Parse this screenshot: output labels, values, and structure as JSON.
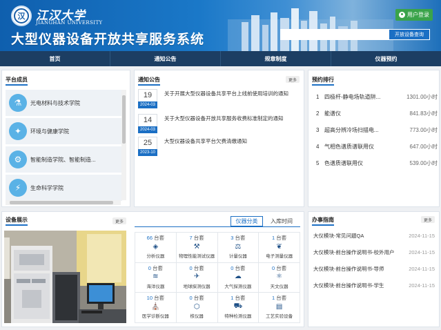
{
  "header": {
    "university_cn": "江汉大学",
    "university_en": "JIANGHAN UNIVERSITY",
    "system_title": "大型仪器设备开放共享服务系统",
    "login_label": "用户登录",
    "search_placeholder": "",
    "search_button": "开放设备查询"
  },
  "nav": [
    "首页",
    "通知公告",
    "规章制度",
    "仪器预约"
  ],
  "members": {
    "title": "平台成员",
    "items": [
      {
        "name": "光电材料与技术学院",
        "icon": "flask-icon"
      },
      {
        "name": "环境与健康学院",
        "icon": "microscope-icon"
      },
      {
        "name": "智能制造学院、智能制造...",
        "icon": "gear-icon"
      },
      {
        "name": "生命科学学院",
        "icon": "bolt-icon"
      }
    ]
  },
  "notices": {
    "title": "通知公告",
    "more": "更多",
    "items": [
      {
        "day": "19",
        "ym": "2024-03",
        "text": "关于开展大型仪器设备共享平台上线前使用培训的通知"
      },
      {
        "day": "14",
        "ym": "2024-03",
        "text": "关于大型仪器设备开放共享服务收费标准制定的通知"
      },
      {
        "day": "25",
        "ym": "2023-10",
        "text": "大型仪器设备共享平台欠费清缴通知"
      }
    ]
  },
  "ranking": {
    "title": "预约排行",
    "items": [
      {
        "rank": "1",
        "name": "四极杆-静电场轨道阱...",
        "value": "1301.00小时"
      },
      {
        "rank": "2",
        "name": "能谱仪",
        "value": "841.83小时"
      },
      {
        "rank": "3",
        "name": "超高分辨冷场扫描电...",
        "value": "773.00小时"
      },
      {
        "rank": "4",
        "name": "气相色谱质谱联用仪",
        "value": "647.00小时"
      },
      {
        "rank": "5",
        "name": "色谱质谱联用仪",
        "value": "539.00小时"
      }
    ]
  },
  "equipment": {
    "title": "设备展示",
    "more": "更多",
    "tabs": [
      "仪器分类",
      "入库时间"
    ],
    "unit": "台套",
    "categories": [
      {
        "count": "66",
        "name": "分析仪器",
        "icon": "cube-icon"
      },
      {
        "count": "7",
        "name": "物理性能测试仪器",
        "icon": "robot-arm-icon"
      },
      {
        "count": "3",
        "name": "计量仪器",
        "icon": "scale-icon"
      },
      {
        "count": "1",
        "name": "电子测量仪器",
        "icon": "leaf-icon"
      },
      {
        "count": "0",
        "name": "海洋仪器",
        "icon": "wave-icon"
      },
      {
        "count": "0",
        "name": "地球探测仪器",
        "icon": "plane-icon"
      },
      {
        "count": "0",
        "name": "大气探测仪器",
        "icon": "cloud-icon"
      },
      {
        "count": "0",
        "name": "天文仪器",
        "icon": "atom-icon"
      },
      {
        "count": "10",
        "name": "医学诊断仪器",
        "icon": "hospital-icon"
      },
      {
        "count": "0",
        "name": "核仪器",
        "icon": "hexagon-icon"
      },
      {
        "count": "1",
        "name": "特种检测仪器",
        "icon": "car-icon"
      },
      {
        "count": "1",
        "name": "工艺实验设备",
        "icon": "document-icon"
      }
    ]
  },
  "guide": {
    "title": "办事指南",
    "more": "更多",
    "items": [
      {
        "title": "大仪模块-常见问题QA",
        "date": "2024-11-15"
      },
      {
        "title": "大仪模块-前台操作说明书-校外用户",
        "date": "2024-11-15"
      },
      {
        "title": "大仪模块-前台操作说明书-导师",
        "date": "2024-11-15"
      },
      {
        "title": "大仪模块-前台操作说明书-学生",
        "date": "2024-11-15"
      }
    ]
  }
}
